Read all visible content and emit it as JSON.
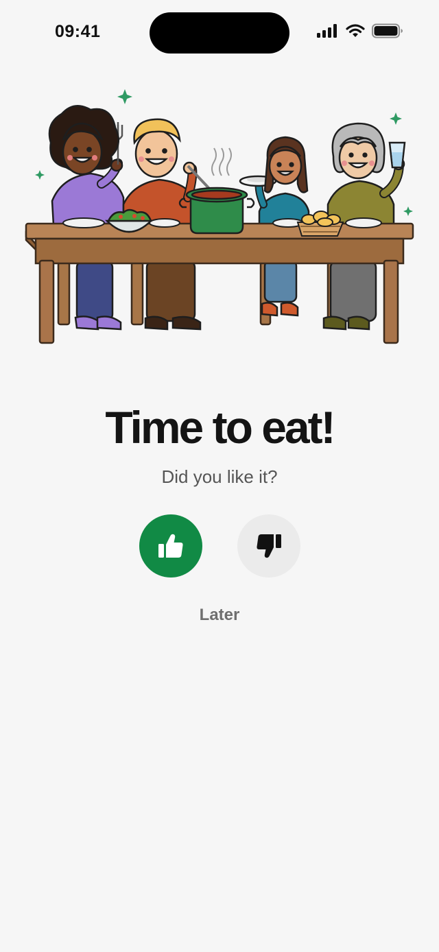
{
  "status_bar": {
    "time": "09:41",
    "icons": [
      "cellular-signal-icon",
      "wifi-icon",
      "battery-icon"
    ]
  },
  "illustration": {
    "subject": "family-dinner-illustration"
  },
  "prompt": {
    "title": "Time to eat!",
    "question": "Did you like it?"
  },
  "actions": {
    "like_icon": "thumbs-up-icon",
    "dislike_icon": "thumbs-down-icon",
    "later_label": "Later"
  },
  "colors": {
    "background": "#f6f6f6",
    "accent_green": "#118a45",
    "neutral_button": "#ebebeb",
    "title_text": "#141414",
    "secondary_text": "#555555"
  }
}
